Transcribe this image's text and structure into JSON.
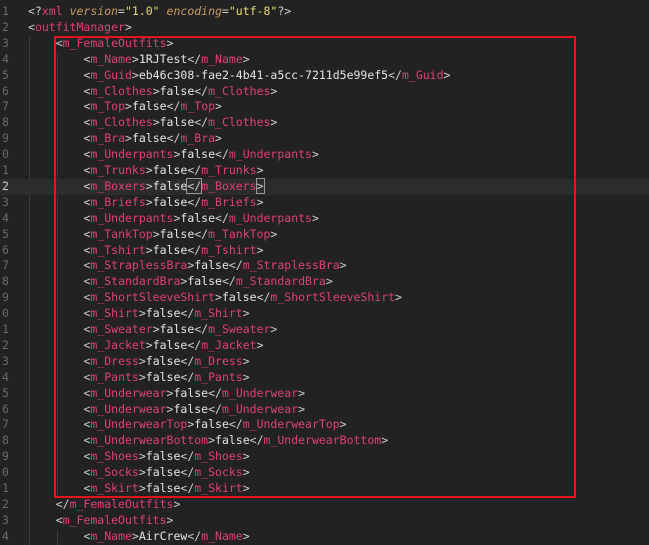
{
  "editor": {
    "prolog": {
      "open": "<?",
      "name": "xml",
      "attr1": "version",
      "eq1": "=",
      "val1": "\"1.0\"",
      "attr2": "encoding",
      "eq2": "=",
      "val2": "\"utf-8\"",
      "close": "?>"
    },
    "line_numbers": [
      "1",
      "2",
      "3",
      "4",
      "5",
      "6",
      "7",
      "8",
      "9",
      "0",
      "1",
      "2",
      "3",
      "4",
      "5",
      "6",
      "7",
      "8",
      "9",
      "0",
      "1",
      "2",
      "3",
      "4",
      "5",
      "6",
      "7",
      "8",
      "9",
      "0",
      "1",
      "2",
      "3",
      "4"
    ],
    "root_tag": "outfitManager",
    "outfit_tag": "m_FemaleOutfits",
    "name_tag": "m_Name",
    "name_value": "1RJTest",
    "guid_tag": "m_Guid",
    "guid_value": "eb46c308-fae2-4b41-a5cc-7211d5e99ef5",
    "fields": [
      {
        "tag": "m_Clothes",
        "value": "false",
        "close": "m_Clothes"
      },
      {
        "tag": "m_Top",
        "value": "false",
        "close": "m_Top"
      },
      {
        "tag": "m_Clothes",
        "value": "false",
        "close": "m_Clothes"
      },
      {
        "tag": "m_Bra",
        "value": "false",
        "close": "m_Bra"
      },
      {
        "tag": "m_Underpants",
        "value": "false",
        "close": "m_Underpants"
      },
      {
        "tag": "m_Trunks",
        "value": "false",
        "close": "m_Trunks"
      },
      {
        "tag": "m_Boxers",
        "value": "false",
        "close": "m_Boxers"
      },
      {
        "tag": "m_Briefs",
        "value": "false",
        "close": "m_Briefs"
      },
      {
        "tag": "m_Underpants",
        "value": "false",
        "close": "m_Underpants"
      },
      {
        "tag": "m_TankTop",
        "value": "false",
        "close": "m_TankTop"
      },
      {
        "tag": "m_Tshirt",
        "value": "false",
        "close": "m_Tshirt"
      },
      {
        "tag": "m_StraplessBra",
        "value": "false",
        "close": "m_StraplessBra"
      },
      {
        "tag": "m_StandardBra",
        "value": "false",
        "close": "m_StandardBra"
      },
      {
        "tag": "m_ShortSleeveShirt",
        "value": "false",
        "close": "m_ShortSleeveShirt"
      },
      {
        "tag": "m_Shirt",
        "value": "false",
        "close": "m_Shirt"
      },
      {
        "tag": "m_Sweater",
        "value": "false",
        "close": "m_Sweater"
      },
      {
        "tag": "m_Jacket",
        "value": "false",
        "close": "m_Jacket"
      },
      {
        "tag": "m_Dress",
        "value": "false",
        "close": "m_Dress"
      },
      {
        "tag": "m_Pants",
        "value": "false",
        "close": "m_Pants"
      },
      {
        "tag": "m_Underwear",
        "value": "false",
        "close": "m_Underwear"
      },
      {
        "tag": "m_Underwear",
        "value": "false",
        "close": "m_Underwear"
      },
      {
        "tag": "m_UnderwearTop",
        "value": "false",
        "close": "m_UnderwearTop"
      },
      {
        "tag": "m_UnderwearBottom",
        "value": "false",
        "close": "m_UnderwearBottom"
      },
      {
        "tag": "m_Shoes",
        "value": "false",
        "close": "m_Shoes"
      },
      {
        "tag": "m_Socks",
        "value": "false",
        "close": "m_Socks"
      },
      {
        "tag": "m_Skirt",
        "value": "false",
        "close": "m_Skirt"
      }
    ],
    "second_outfit_name": "AirCrew",
    "cursor_field_index": 6
  },
  "colors": {
    "background": "#222222",
    "tag": "#e0407a",
    "text": "#e6e6e6",
    "highlight_box": "#e3141f"
  }
}
